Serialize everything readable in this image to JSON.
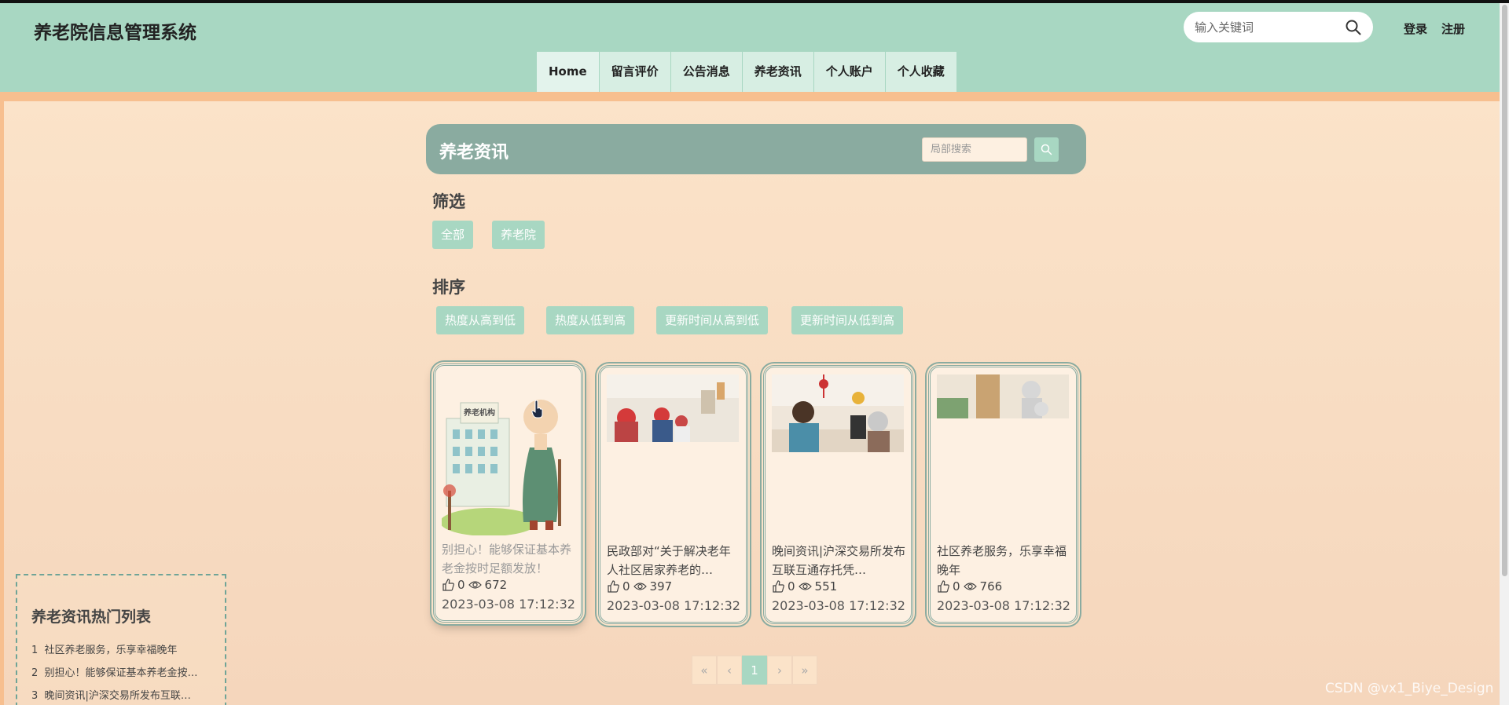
{
  "header": {
    "title": "养老院信息管理系统",
    "search_placeholder": "输入关键词",
    "login": "登录",
    "register": "注册"
  },
  "nav": {
    "items": [
      "Home",
      "留言评价",
      "公告消息",
      "养老资讯",
      "个人账户",
      "个人收藏"
    ],
    "active": "Home"
  },
  "section": {
    "title": "养老资讯",
    "search_placeholder": "局部搜索"
  },
  "filter": {
    "label": "筛选",
    "options": [
      "全部",
      "养老院"
    ]
  },
  "sort": {
    "label": "排序",
    "options": [
      "热度从高到低",
      "热度从低到高",
      "更新时间从高到低",
      "更新时间从低到高"
    ]
  },
  "cards": [
    {
      "title": "别担心！能够保证基本养老金按时足额发放！",
      "likes": "0",
      "views": "672",
      "date": "2023-03-08 17:12:32"
    },
    {
      "title": "民政部对“关于解决老年人社区居家养老的…",
      "likes": "0",
      "views": "397",
      "date": "2023-03-08 17:12:32"
    },
    {
      "title": "晚间资讯|沪深交易所发布互联互通存托凭…",
      "likes": "0",
      "views": "551",
      "date": "2023-03-08 17:12:32"
    },
    {
      "title": "社区养老服务，乐享幸福晚年",
      "likes": "0",
      "views": "766",
      "date": "2023-03-08 17:12:32"
    }
  ],
  "card1_image_sign": "养老机构",
  "pagination": {
    "first": "«",
    "prev": "‹",
    "current": "1",
    "next": "›",
    "last": "»"
  },
  "hot_list": {
    "title": "养老资讯热门列表",
    "items": [
      {
        "num": "1",
        "text": "社区养老服务，乐享幸福晚年"
      },
      {
        "num": "2",
        "text": "别担心！能够保证基本养老金按…"
      },
      {
        "num": "3",
        "text": "晚间资讯|沪深交易所发布互联…"
      }
    ]
  },
  "watermark": "CSDN @vx1_Biye_Design",
  "colors": {
    "header": "#a8d7c2",
    "accent_bar": "#f7bf8f",
    "background": "#fbe3c9",
    "section_head": "#8aaba0"
  }
}
